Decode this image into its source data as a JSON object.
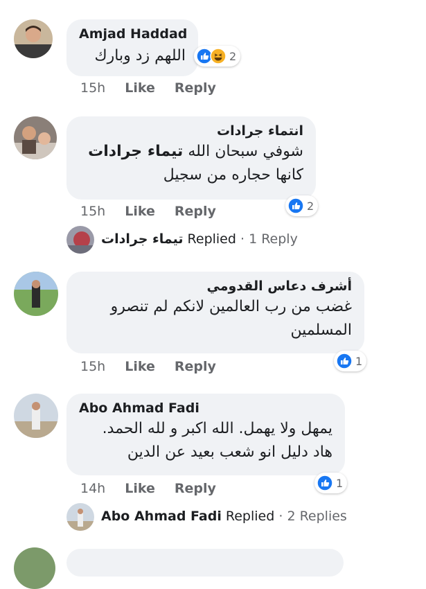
{
  "comments": [
    {
      "author": "Amjad Haddad",
      "text_lines": [
        "اللهم زد وبارك"
      ],
      "reaction_count": "2",
      "reactions": [
        "like-icon",
        "haha-icon"
      ],
      "time": "15h",
      "like_label": "Like",
      "reply_label": "Reply"
    },
    {
      "author": "انتماء جرادات",
      "tag": "تيماء جرادات",
      "text_lines": [
        "شوفي سبحان الله",
        "كانها حجاره من سجيل"
      ],
      "reaction_count": "2",
      "reactions": [
        "like-icon"
      ],
      "time": "15h",
      "like_label": "Like",
      "reply_label": "Reply",
      "replied": {
        "name": "تيماء جرادات",
        "label": "Replied",
        "sep": "·",
        "count": "1 Reply"
      }
    },
    {
      "author": "أشرف دعاس القدومي",
      "text_lines": [
        "غضب من رب العالمين لانكم لم تنصرو",
        "المسلمين"
      ],
      "reaction_count": "1",
      "reactions": [
        "like-icon"
      ],
      "time": "15h",
      "like_label": "Like",
      "reply_label": "Reply"
    },
    {
      "author": "Abo Ahmad Fadi",
      "text_lines": [
        "يمهل ولا يهمل. الله اكبر و لله الحمد.",
        "هاد دليل انو شعب بعيد عن الدين"
      ],
      "reaction_count": "1",
      "reactions": [
        "like-icon"
      ],
      "time": "14h",
      "like_label": "Like",
      "reply_label": "Reply",
      "replied": {
        "name": "Abo Ahmad Fadi",
        "label": "Replied",
        "sep": "·",
        "count": "2 Replies"
      }
    }
  ],
  "colors": {
    "bubble": "#f0f2f5",
    "like_blue": "#1877f2",
    "haha_yellow": "#f7b125",
    "meta_gray": "#65676b"
  }
}
